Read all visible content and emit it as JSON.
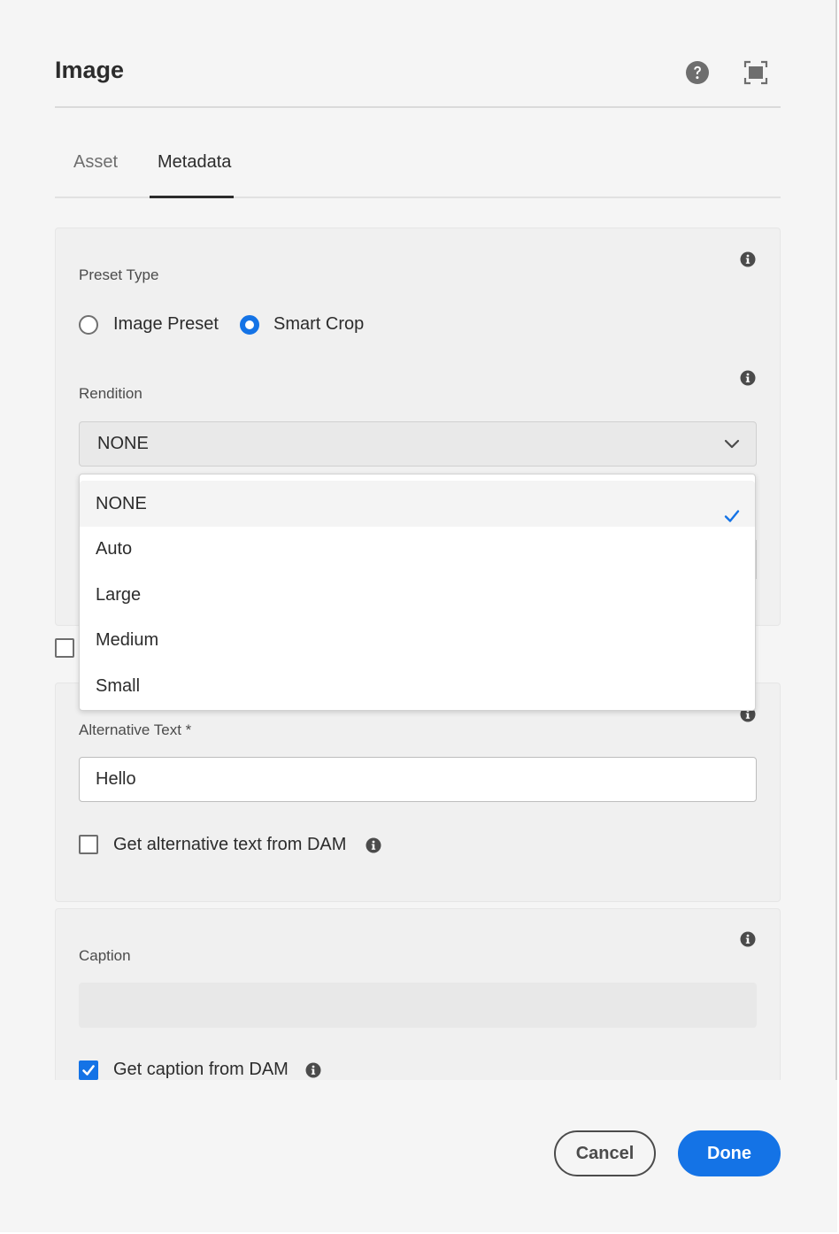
{
  "dialog": {
    "title": "Image",
    "help_icon": "help-circle-icon",
    "fullscreen_icon": "fullscreen-icon"
  },
  "tabs": [
    {
      "label": "Asset",
      "selected": false
    },
    {
      "label": "Metadata",
      "selected": true
    }
  ],
  "preset": {
    "label": "Preset Type",
    "options": [
      {
        "label": "Image Preset",
        "checked": false
      },
      {
        "label": "Smart Crop",
        "checked": true
      }
    ]
  },
  "rendition": {
    "label": "Rendition",
    "value": "NONE",
    "options": [
      "NONE",
      "Auto",
      "Large",
      "Medium",
      "Small"
    ],
    "selected": "NONE"
  },
  "alt_text": {
    "label": "Alternative Text *",
    "value": "Hello",
    "dam_label": "Get alternative text from DAM",
    "dam_checked": false
  },
  "caption": {
    "label": "Caption",
    "value": "",
    "dam_label": "Get caption from DAM",
    "dam_checked": true
  },
  "footer": {
    "cancel_label": "Cancel",
    "done_label": "Done"
  },
  "colors": {
    "accent": "#1473e6",
    "background": "#f5f5f5",
    "text": "#2c2c2c"
  }
}
